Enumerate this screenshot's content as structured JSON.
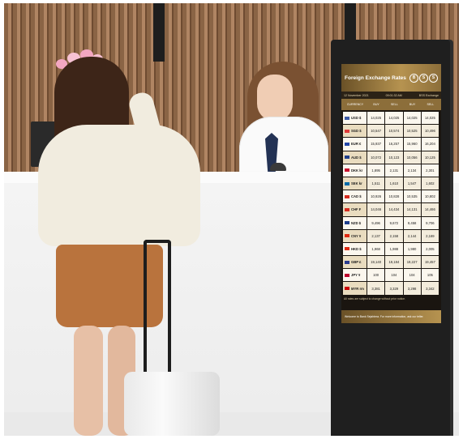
{
  "board": {
    "title": "Foreign Exchange Rates",
    "logo": [
      "B",
      "S",
      "S"
    ],
    "date": "12 November 2021",
    "time": "09:01:32 AM",
    "exchange": "BSS Exchange",
    "columns": [
      "CURRENCY",
      "BUY",
      "SELL",
      "BUY",
      "SELL"
    ],
    "rows": [
      {
        "currency": "USD $",
        "flag": "#3c5aa6",
        "values": [
          "14,025",
          "14,025",
          "14,025",
          "14,025"
        ]
      },
      {
        "currency": "SGD $",
        "flag": "#e03b3b",
        "values": [
          "10,547",
          "10,574",
          "10,525",
          "10,496"
        ]
      },
      {
        "currency": "EUR €",
        "flag": "#2447a8",
        "values": [
          "15,937",
          "16,257",
          "15,960",
          "16,204"
        ]
      },
      {
        "currency": "AUD $",
        "flag": "#1f3f8c",
        "values": [
          "10,072",
          "10,123",
          "10,056",
          "10,125"
        ]
      },
      {
        "currency": "DKK kr",
        "flag": "#c8102e",
        "values": [
          "1,895",
          "2,131",
          "2,134",
          "2,301"
        ]
      },
      {
        "currency": "SEK kr",
        "flag": "#006aa7",
        "values": [
          "1,511",
          "1,610",
          "1,547",
          "1,602"
        ]
      },
      {
        "currency": "CAD $",
        "flag": "#d52b1e",
        "values": [
          "10,926",
          "10,828",
          "10,535",
          "10,802"
        ]
      },
      {
        "currency": "CHF ₣",
        "flag": "#d52b1e",
        "values": [
          "14,046",
          "14,434",
          "14,131",
          "14,466"
        ]
      },
      {
        "currency": "NZD $",
        "flag": "#1f3f8c",
        "values": [
          "9,496",
          "9,672",
          "9,458",
          "9,706"
        ]
      },
      {
        "currency": "CNY ¥",
        "flag": "#de2910",
        "values": [
          "2,137",
          "2,158",
          "2,144",
          "2,169"
        ]
      },
      {
        "currency": "HKD $",
        "flag": "#de2910",
        "values": [
          "1,968",
          "1,988",
          "1,980",
          "2,005"
        ]
      },
      {
        "currency": "GBP £",
        "flag": "#2a3b8f",
        "values": [
          "19,140",
          "19,184",
          "19,227",
          "19,457"
        ]
      },
      {
        "currency": "JPY ¥",
        "flag": "#bc002d",
        "values": [
          "100",
          "104",
          "104",
          "105"
        ]
      },
      {
        "currency": "MYR rm",
        "flag": "#cc0001",
        "values": [
          "3,381",
          "3,329",
          "3,298",
          "3,342"
        ]
      }
    ],
    "note": "All rates are subject to change without prior notice.",
    "footer": "Welcome to Bank Sejahtera. For more information, ask our teller."
  },
  "colors": {
    "wood": "#8a6445",
    "gold": "#b69350",
    "kiosk": "#1f1f1f"
  }
}
